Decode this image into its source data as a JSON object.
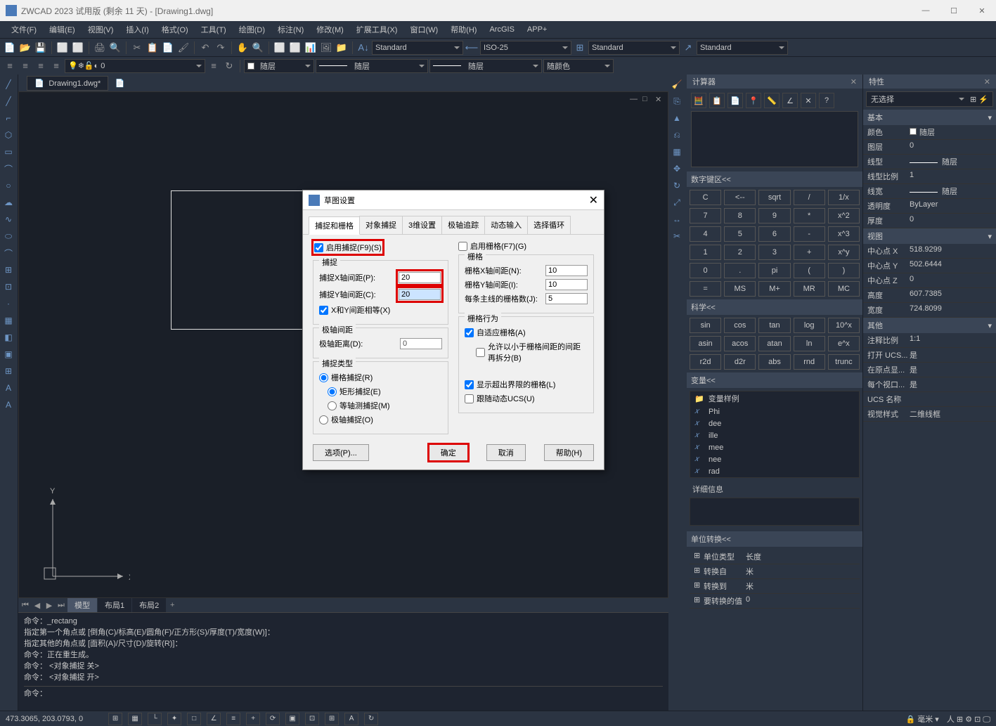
{
  "title": "ZWCAD 2023 试用版 (剩余 11 天) - [Drawing1.dwg]",
  "menu": [
    "文件(F)",
    "编辑(E)",
    "视图(V)",
    "插入(I)",
    "格式(O)",
    "工具(T)",
    "绘图(D)",
    "标注(N)",
    "修改(M)",
    "扩展工具(X)",
    "窗口(W)",
    "帮助(H)",
    "ArcGIS",
    "APP+"
  ],
  "toolbar2": {
    "combo1": "随层",
    "combo2": "随层",
    "combo3": "随层",
    "combo4": "随颜色"
  },
  "standards": {
    "std1": "Standard",
    "std2": "ISO-25",
    "std3": "Standard",
    "std4": "Standard"
  },
  "file_tab": "Drawing1.dwg*",
  "model_tabs": [
    "模型",
    "布局1",
    "布局2"
  ],
  "command_lines": [
    "命令：_rectang",
    "指定第一个角点或 [倒角(C)/标高(E)/圆角(F)/正方形(S)/厚度(T)/宽度(W)]：",
    "指定其他的角点或 [面积(A)/尺寸(D)/旋转(R)]：",
    "命令：正在重生成。",
    "命令： <对象捕捉 关>",
    "命令： <对象捕捉 开>"
  ],
  "command_prompt": "命令：",
  "dialog": {
    "title": "草图设置",
    "tabs": [
      "捕捉和栅格",
      "对象捕捉",
      "3维设置",
      "极轴追踪",
      "动态输入",
      "选择循环"
    ],
    "enable_snap": "启用捕捉(F9)(S)",
    "enable_grid": "启用栅格(F7)(G)",
    "grp_snap": "捕捉",
    "snap_x_label": "捕捉X轴间距(P):",
    "snap_x_val": "20",
    "snap_y_label": "捕捉Y轴间距(C):",
    "snap_y_val": "20",
    "xy_equal": "X和Y间距相等(X)",
    "grp_polar": "极轴间距",
    "polar_dist_label": "极轴距离(D):",
    "polar_dist_val": "0",
    "grp_snap_type": "捕捉类型",
    "rt_grid_snap": "栅格捕捉(R)",
    "rt_rect": "矩形捕捉(E)",
    "rt_iso": "等轴测捕捉(M)",
    "rt_polar": "极轴捕捉(O)",
    "grp_grid": "栅格",
    "grid_x_label": "栅格X轴间距(N):",
    "grid_x_val": "10",
    "grid_y_label": "栅格Y轴间距(I):",
    "grid_y_val": "10",
    "grid_major_label": "每条主线的栅格数(J):",
    "grid_major_val": "5",
    "grp_grid_behavior": "栅格行为",
    "cb_adaptive": "自适应栅格(A)",
    "cb_subdiv": "允许以小于栅格间距的间距再拆分(B)",
    "cb_limits": "显示超出界限的栅格(L)",
    "cb_ducs": "跟随动态UCS(U)",
    "btn_options": "选项(P)...",
    "btn_ok": "确定",
    "btn_cancel": "取消",
    "btn_help": "帮助(H)"
  },
  "calc": {
    "title": "计算器",
    "section_num": "数字键区<<",
    "keys": [
      [
        "C",
        "<--",
        "sqrt",
        "/",
        "1/x"
      ],
      [
        "7",
        "8",
        "9",
        "*",
        "x^2"
      ],
      [
        "4",
        "5",
        "6",
        "-",
        "x^3"
      ],
      [
        "1",
        "2",
        "3",
        "+",
        "x^y"
      ],
      [
        "0",
        ".",
        "pi",
        "(",
        ")"
      ],
      [
        "=",
        "MS",
        "M+",
        "MR",
        "MC"
      ]
    ],
    "section_sci": "科学<<",
    "sci": [
      [
        "sin",
        "cos",
        "tan",
        "log",
        "10^x"
      ],
      [
        "asin",
        "acos",
        "atan",
        "ln",
        "e^x"
      ],
      [
        "r2d",
        "d2r",
        "abs",
        "rnd",
        "trunc"
      ]
    ],
    "section_units": "单位转换<<",
    "unit_type_label": "单位类型",
    "unit_type": "长度",
    "from_label": "转换自",
    "from_val": "米",
    "to_label": "转换到",
    "to_val": "米",
    "convert_label": "要转换的值",
    "convert_val": "0",
    "section_vars": "变量<<",
    "var_sample": "变量样例",
    "vars": [
      "Phi",
      "dee",
      "ille",
      "mee",
      "nee",
      "rad"
    ],
    "detail": "详细信息"
  },
  "props": {
    "title": "特性",
    "no_select": "无选择",
    "sec_basic": "基本",
    "rows_basic": [
      [
        "颜色",
        "随层"
      ],
      [
        "图层",
        "0"
      ],
      [
        "线型",
        "随层"
      ],
      [
        "线型比例",
        "1"
      ],
      [
        "线宽",
        "随层"
      ],
      [
        "透明度",
        "ByLayer"
      ],
      [
        "厚度",
        "0"
      ]
    ],
    "sec_view": "视图",
    "rows_view": [
      [
        "中心点 X",
        "518.9299"
      ],
      [
        "中心点 Y",
        "502.6444"
      ],
      [
        "中心点 Z",
        "0"
      ],
      [
        "高度",
        "607.7385"
      ],
      [
        "宽度",
        "724.8099"
      ]
    ],
    "sec_other": "其他",
    "rows_other": [
      [
        "注释比例",
        "1:1"
      ],
      [
        "打开 UCS...",
        "是"
      ],
      [
        "在原点显...",
        "是"
      ],
      [
        "每个视口...",
        "是"
      ],
      [
        "UCS 名称",
        ""
      ],
      [
        "视觉样式",
        "二维线框"
      ]
    ]
  },
  "status": {
    "coords": "473.3065, 203.0793, 0",
    "mm_label": "毫米"
  },
  "axis_labels": {
    "x": "X",
    "y": "Y"
  }
}
